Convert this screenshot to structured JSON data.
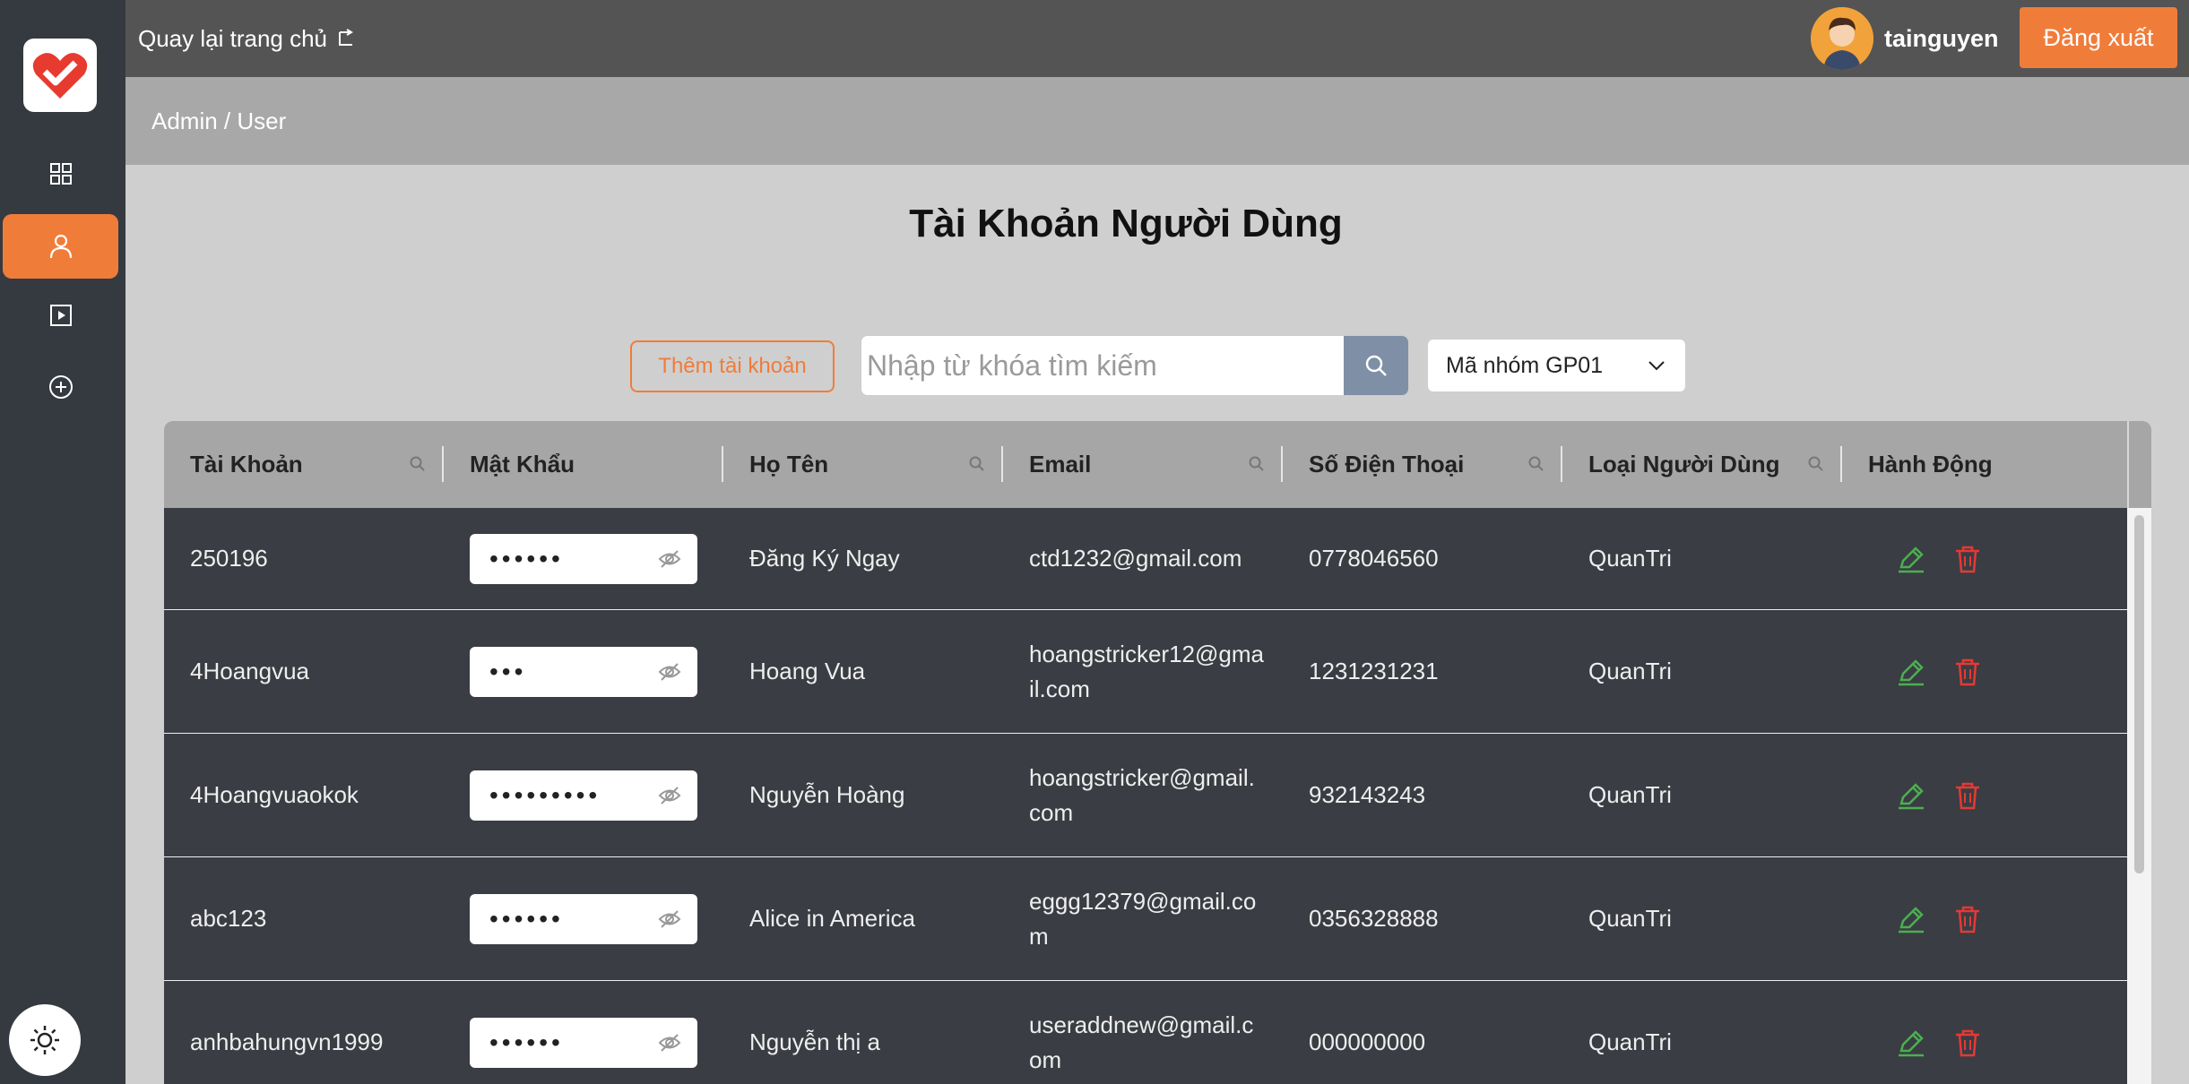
{
  "topbar": {
    "back_label": "Quay lại trang chủ",
    "username": "tainguyen",
    "logout_label": "Đăng xuất"
  },
  "breadcrumb": "Admin / User",
  "page_title": "Tài Khoản Người Dùng",
  "toolbar": {
    "add_label": "Thêm tài khoản",
    "search_placeholder": "Nhập từ khóa tìm kiếm",
    "group_value": "Mã nhóm GP01"
  },
  "columns": [
    "Tài Khoản",
    "Mật Khẩu",
    "Họ Tên",
    "Email",
    "Số Điện Thoại",
    "Loại Người Dùng",
    "Hành Động"
  ],
  "rows": [
    {
      "account": "250196",
      "password_mask": "••••••",
      "name": "Đăng Ký Ngay",
      "email": "ctd1232@gmail.com",
      "phone": "0778046560",
      "type": "QuanTri"
    },
    {
      "account": "4Hoangvua",
      "password_mask": "•••",
      "name": "Hoang Vua",
      "email": "hoangstricker12@gmail.com",
      "phone": "1231231231",
      "type": "QuanTri"
    },
    {
      "account": "4Hoangvuaokok",
      "password_mask": "•••••••••",
      "name": "Nguyễn Hoàng",
      "email": "hoangstricker@gmail.com",
      "phone": "932143243",
      "type": "QuanTri"
    },
    {
      "account": "abc123",
      "password_mask": "••••••",
      "name": "Alice in America",
      "email": "eggg12379@gmail.com",
      "phone": "0356328888",
      "type": "QuanTri"
    },
    {
      "account": "anhbahungvn1999",
      "password_mask": "••••••",
      "name": "Nguyễn thị a",
      "email": "useraddnew@gmail.com",
      "phone": "000000000",
      "type": "QuanTri"
    }
  ],
  "colors": {
    "accent": "#f07c3a",
    "sidebar": "#353a40",
    "topbar": "#545454",
    "table_body": "#3a3d43",
    "edit": "#4caf50",
    "delete": "#e53935"
  }
}
